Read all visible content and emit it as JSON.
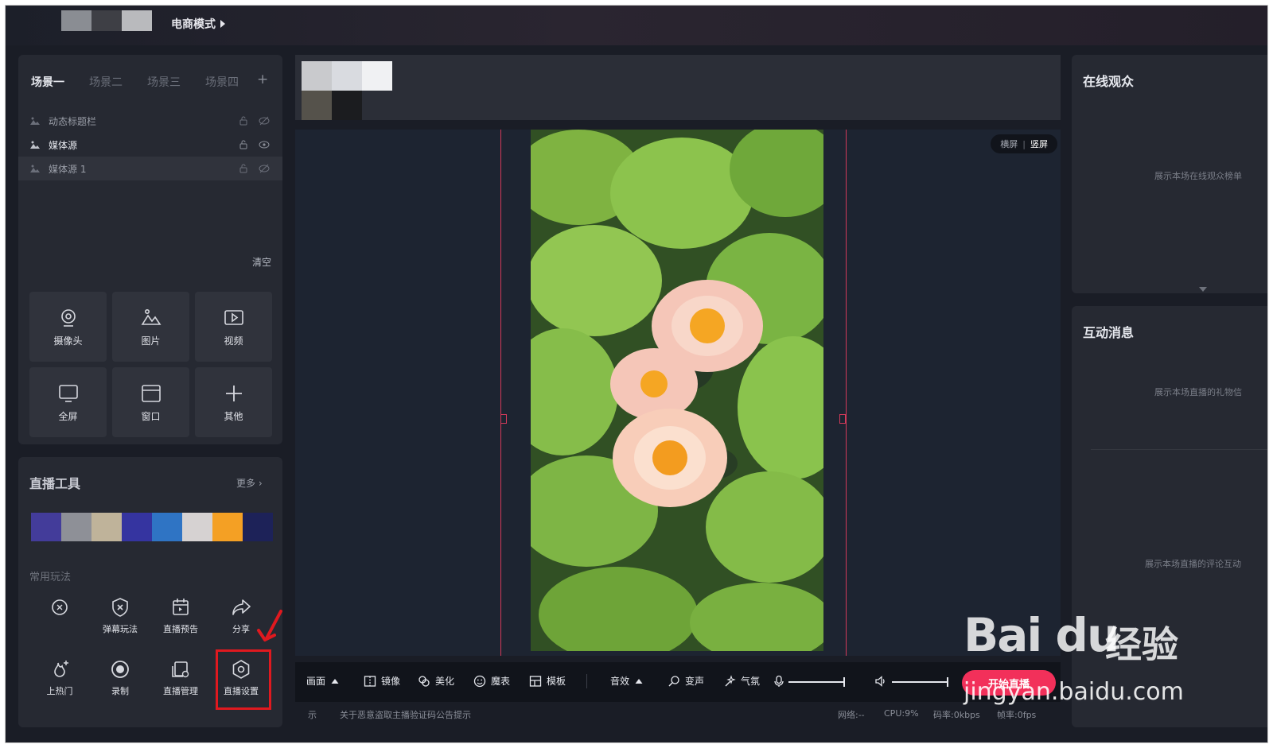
{
  "app": {
    "mode_label": "电商模式"
  },
  "scenes": {
    "tabs": [
      "场景一",
      "场景二",
      "场景三",
      "场景四"
    ],
    "add_icon": "plus-icon",
    "sources": [
      {
        "name": "动态标题栏",
        "icon": "image-icon",
        "visible": false
      },
      {
        "name": "媒体源",
        "icon": "image-icon",
        "visible": true
      },
      {
        "name": "媒体源 1",
        "icon": "image-icon",
        "visible": false
      }
    ],
    "clear_label": "清空"
  },
  "media_buttons": [
    {
      "label": "摄像头",
      "icon": "camera-icon"
    },
    {
      "label": "图片",
      "icon": "picture-icon"
    },
    {
      "label": "视频",
      "icon": "video-icon"
    },
    {
      "label": "全屏",
      "icon": "monitor-icon"
    },
    {
      "label": "窗口",
      "icon": "window-icon"
    },
    {
      "label": "其他",
      "icon": "plus-icon"
    }
  ],
  "live_tools": {
    "title": "直播工具",
    "more_label": "更多",
    "colors": [
      "#433c9a",
      "#8e9097",
      "#bfb39a",
      "#3534a0",
      "#2f74c4",
      "#d6d2d2",
      "#f4a024",
      "#1d2258"
    ],
    "common_title": "常用玩法",
    "items": [
      {
        "label": "",
        "icon": "gift-ring-icon"
      },
      {
        "label": "弹幕玩法",
        "icon": "shield-x-icon"
      },
      {
        "label": "直播预告",
        "icon": "calendar-icon"
      },
      {
        "label": "分享",
        "icon": "share-icon"
      },
      {
        "label": "上热门",
        "icon": "flame-plus-icon"
      },
      {
        "label": "录制",
        "icon": "record-icon"
      },
      {
        "label": "直播管理",
        "icon": "manage-icon"
      },
      {
        "label": "直播设置",
        "icon": "settings-hex-icon"
      }
    ]
  },
  "preview": {
    "orientation": {
      "landscape": "横屏",
      "portrait": "竖屏",
      "active": "portrait"
    }
  },
  "toolbar": {
    "items": [
      {
        "label": "画面",
        "icon": "caret-up-icon"
      },
      {
        "label": "镜像",
        "icon": "mirror-icon"
      },
      {
        "label": "美化",
        "icon": "beautify-icon"
      },
      {
        "label": "魔表",
        "icon": "magic-face-icon"
      },
      {
        "label": "模板",
        "icon": "template-icon"
      },
      {
        "label": "音效",
        "icon": "caret-up-icon"
      },
      {
        "label": "变声",
        "icon": "voice-change-icon"
      },
      {
        "label": "气氛",
        "icon": "atmosphere-icon"
      }
    ],
    "mic_icon": "microphone-icon",
    "speaker_icon": "speaker-icon",
    "go_live_label": "开始直播"
  },
  "statusbar": {
    "notice_prefix": "示",
    "notice": "关于恶意盗取主播验证码公告提示",
    "network": "网络:--",
    "cpu": "CPU:9%",
    "bitrate": "码率:0kbps",
    "framerate": "帧率:0fps"
  },
  "audience": {
    "title": "在线观众",
    "hint": "展示本场在线观众榜单"
  },
  "interactions": {
    "title": "互动消息",
    "hint_gifts": "展示本场直播的礼物信",
    "hint_comments": "展示本场直播的评论互动"
  },
  "watermark": {
    "brand": "Bai du",
    "jingyan": "经验",
    "url": "jingyan.baidu.com"
  }
}
